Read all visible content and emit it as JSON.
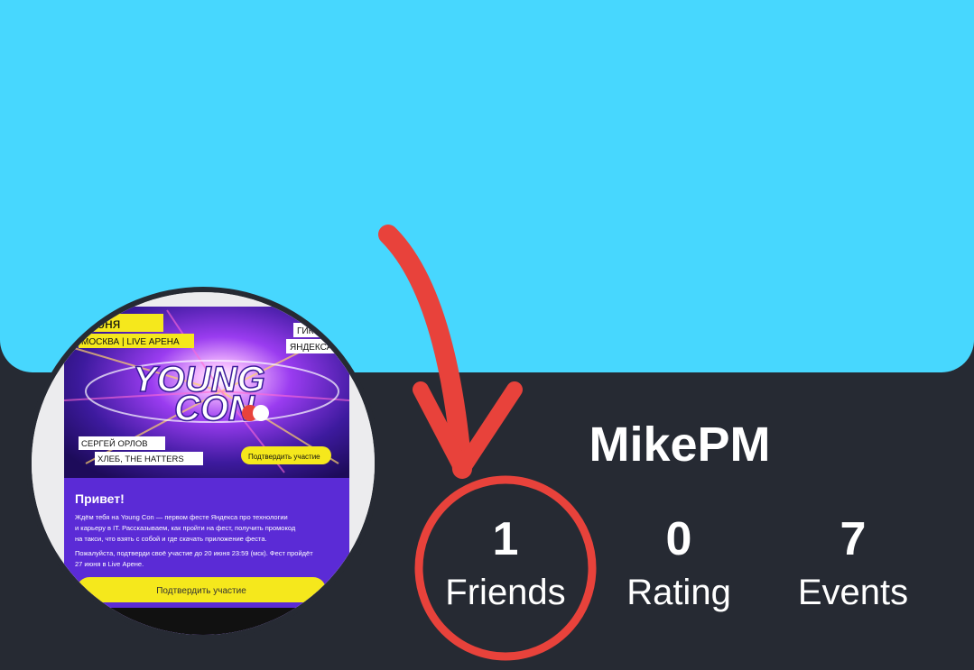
{
  "profile": {
    "username": "MikePM",
    "stats": [
      {
        "value": "1",
        "label": "Friends"
      },
      {
        "value": "0",
        "label": "Rating"
      },
      {
        "value": "7",
        "label": "Events"
      }
    ]
  },
  "avatar_poster": {
    "date_tag": "июня",
    "venue_tag": "МОСКВА | LIVE АРЕНА",
    "corner_tag_1": "ГИК-Ф",
    "corner_tag_2": "ЯНДЕКСА",
    "logo_line_1": "YOUNG",
    "logo_line_2": "CON",
    "artist_1": "СЕРГЕЙ ОРЛОВ",
    "artist_2": "ХЛЕБ, THE HATTERS",
    "small_button": "Подтвердить участие",
    "greeting": "Привет!",
    "body_1": "Ждём тебя на Young Con — первом фесте Яндекса про технологии",
    "body_2": "и карьеру в IT. Рассказываем, как пройти на фест, получить промокод",
    "body_3": "на такси, что взять с собой и где скачать приложение феста.",
    "body_4": "Пожалуйста, подтверди своё участие до 20 июня 23:59 (мск). Фест пройдёт",
    "body_5": "27 июня в Live Арене.",
    "main_button": "Подтвердить участие"
  },
  "colors": {
    "cover": "#47d7fe",
    "background": "#262a33",
    "annotation": "#e8423b",
    "poster_purple": "#5b2bd6",
    "poster_yellow": "#f5e81c"
  },
  "icons": {
    "annotation_arrow": "arrow-down-icon",
    "annotation_circle": "highlight-circle"
  }
}
